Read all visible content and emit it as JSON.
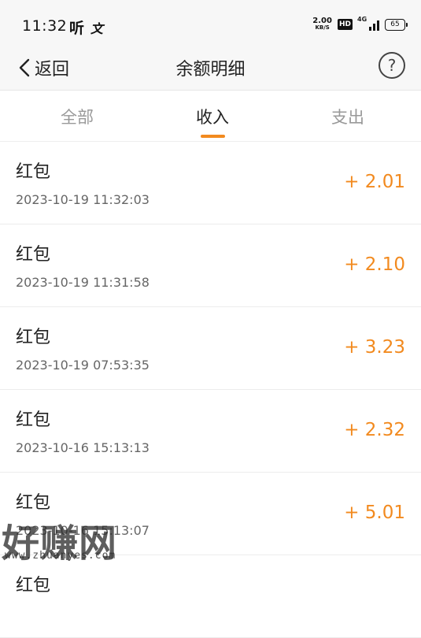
{
  "status_bar": {
    "time": "11:32",
    "app_icons": [
      "听",
      "文"
    ],
    "net_speed_value": "2.00",
    "net_speed_unit": "KB/S",
    "hd_label": "HD",
    "signal_label": "4G",
    "battery_level": "65"
  },
  "nav": {
    "back_label": "返回",
    "title": "余额明细",
    "help_label": "?"
  },
  "tabs": [
    {
      "label": "全部",
      "active": false
    },
    {
      "label": "收入",
      "active": true
    },
    {
      "label": "支出",
      "active": false
    }
  ],
  "accent_color": "#f28a1f",
  "transactions": [
    {
      "title": "红包",
      "time": "2023-10-19 11:32:03",
      "amount": "+ 2.01"
    },
    {
      "title": "红包",
      "time": "2023-10-19 11:31:58",
      "amount": "+ 2.10"
    },
    {
      "title": "红包",
      "time": "2023-10-19 07:53:35",
      "amount": "+ 3.23"
    },
    {
      "title": "红包",
      "time": "2023-10-16 15:13:13",
      "amount": "+ 2.32"
    },
    {
      "title": "红包",
      "time": "2023-10-16 15:13:07",
      "amount": "+ 5.01"
    },
    {
      "title": "红包",
      "time": "",
      "amount": ""
    }
  ],
  "watermark": {
    "text": "好赚网",
    "url": "www.zhuanyes.com"
  }
}
